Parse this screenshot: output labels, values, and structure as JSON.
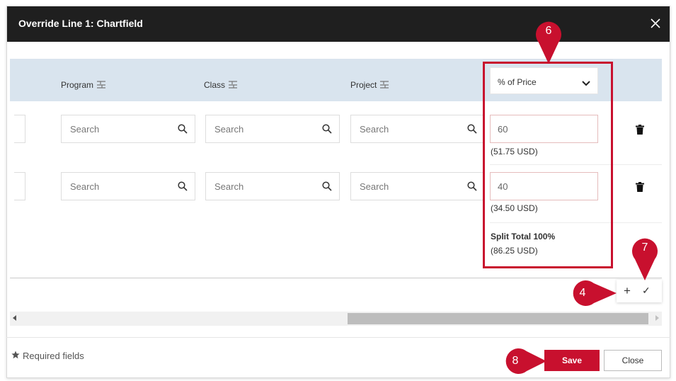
{
  "dialog": {
    "title": "Override Line 1: Chartfield"
  },
  "grid": {
    "columns": [
      {
        "label": "Program"
      },
      {
        "label": "Class"
      },
      {
        "label": "Project"
      }
    ],
    "split_type": "% of Price",
    "rows": [
      {
        "program_placeholder": "Search",
        "class_placeholder": "Search",
        "project_placeholder": "Search",
        "percent": "60",
        "amount": "(51.75 USD)"
      },
      {
        "program_placeholder": "Search",
        "class_placeholder": "Search",
        "project_placeholder": "Search",
        "percent": "40",
        "amount": "(34.50 USD)"
      }
    ],
    "split_total_label": "Split Total 100%",
    "split_total_amount": "(86.25 USD)",
    "add_glyph": "+",
    "confirm_glyph": "✓"
  },
  "footer": {
    "required_label": "Required fields",
    "save_label": "Save",
    "close_label": "Close"
  },
  "annotations": {
    "accent_color": "#c8102e",
    "callouts": [
      "6",
      "7",
      "4",
      "8"
    ]
  }
}
